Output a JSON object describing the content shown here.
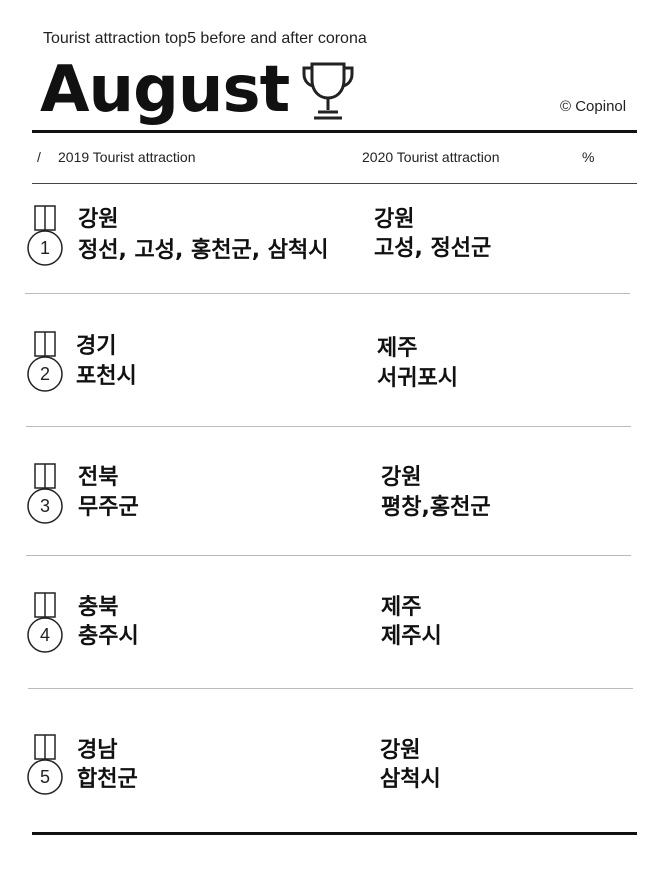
{
  "header": {
    "subtitle": "Tourist attraction top5 before and after corona",
    "title": "August",
    "copyright": "© Copinol"
  },
  "columns": {
    "slash": "/",
    "col2019": "2019 Tourist attraction",
    "col2020": "2020 Tourist attraction",
    "percent": "%"
  },
  "icons": {
    "trophy": "trophy-icon",
    "medal": "medal-icon"
  },
  "rows": [
    {
      "rank": "1",
      "y2019_region": "강원",
      "y2019_places": "정선, 고성, 홍천군, 삼척시",
      "y2020_region": "강원",
      "y2020_places": "고성, 정선군"
    },
    {
      "rank": "2",
      "y2019_region": "경기",
      "y2019_places": "포천시",
      "y2020_region": "제주",
      "y2020_places": "서귀포시"
    },
    {
      "rank": "3",
      "y2019_region": "전북",
      "y2019_places": "무주군",
      "y2020_region": "강원",
      "y2020_places": "평창,홍천군"
    },
    {
      "rank": "4",
      "y2019_region": "충북",
      "y2019_places": "충주시",
      "y2020_region": "제주",
      "y2020_places": "제주시"
    },
    {
      "rank": "5",
      "y2019_region": "경남",
      "y2019_places": "합천군",
      "y2020_region": "강원",
      "y2020_places": "삼척시"
    }
  ]
}
